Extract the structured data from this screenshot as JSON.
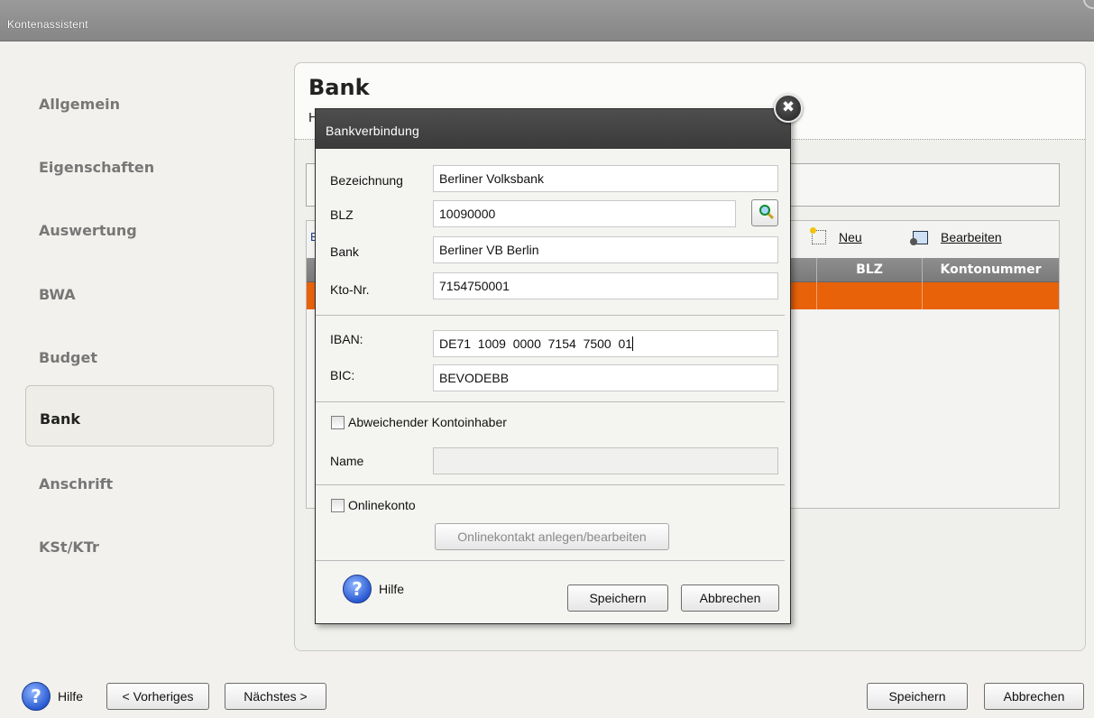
{
  "window": {
    "title": "Kontenassistent"
  },
  "nav": {
    "items": [
      {
        "label": "Allgemein"
      },
      {
        "label": "Eigenschaften"
      },
      {
        "label": "Auswertung"
      },
      {
        "label": "BWA"
      },
      {
        "label": "Budget"
      },
      {
        "label": "Bank"
      },
      {
        "label": "Anschrift"
      },
      {
        "label": "KSt/KTr"
      }
    ],
    "active": "Bank"
  },
  "panel": {
    "title": "Bank",
    "subtitle_visible": "H",
    "desc_visible": "I",
    "grid_title_visible": "B",
    "toolbar": {
      "new_label": "Neu",
      "edit_label": "Bearbeiten"
    },
    "columns": [
      "BLZ",
      "Kontonummer"
    ],
    "selected_row_color": "#e8620a"
  },
  "bottom": {
    "help_label": "Hilfe",
    "prev_label": "< Vorheriges",
    "next_label": "Nächstes >",
    "save_label": "Speichern",
    "cancel_label": "Abbrechen"
  },
  "dialog": {
    "title": "Bankverbindung",
    "close_glyph": "✖",
    "fields": {
      "bezeichnung": {
        "label": "Bezeichnung",
        "value": "Berliner Volksbank"
      },
      "blz": {
        "label": "BLZ",
        "value": "10090000"
      },
      "bank": {
        "label": "Bank",
        "value": "Berliner VB Berlin"
      },
      "kto": {
        "label": "Kto-Nr.",
        "value": "7154750001"
      },
      "iban": {
        "label": "IBAN:",
        "value": "DE71  1009  0000  7154  7500  01"
      },
      "bic": {
        "label": "BIC:",
        "value": "BEVODEBB"
      },
      "name": {
        "label": "Name",
        "value": ""
      }
    },
    "abweichender_label": "Abweichender Kontoinhaber",
    "onlinekonto_label": "Onlinekonto",
    "onlinekontakt_label": "Onlinekontakt anlegen/bearbeiten",
    "help_label": "Hilfe",
    "save_label": "Speichern",
    "cancel_label": "Abbrechen"
  },
  "icons": {
    "help": "?",
    "search": "magnifier-icon",
    "new": "new-document-icon",
    "edit": "edit-icon"
  }
}
